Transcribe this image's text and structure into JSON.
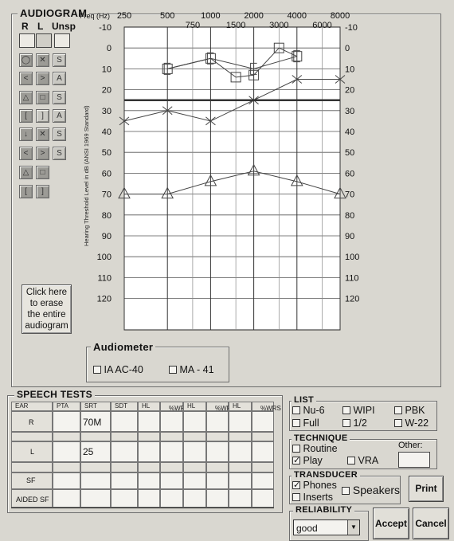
{
  "audiogram": {
    "title": "AUDIOGRAM",
    "ear_labels": [
      "R",
      "L",
      "Unsp"
    ],
    "freq_axis_label": "Freq (Hz)",
    "freq_top": [
      "250",
      "500",
      "1000",
      "2000",
      "4000",
      "8000"
    ],
    "freq_mid": [
      "750",
      "1500",
      "3000",
      "6000"
    ],
    "db_ticks": [
      "-10",
      "0",
      "10",
      "20",
      "30",
      "40",
      "50",
      "60",
      "70",
      "80",
      "90",
      "100",
      "110",
      "120"
    ],
    "y_axis_label": "Hearing Threshold Level in dB (ANSI 1969 Standard)",
    "erase_button": [
      "Click here",
      "to erase",
      "the entire",
      "audiogram"
    ]
  },
  "chart_data": {
    "type": "line",
    "x_scale": "log",
    "x_labels_major": [
      "250",
      "500",
      "1000",
      "2000",
      "4000",
      "8000"
    ],
    "x_labels_minor": [
      "750",
      "1500",
      "3000",
      "6000"
    ],
    "ylim": [
      -10,
      120
    ],
    "y_inverted": true,
    "y_ticks": [
      -10,
      0,
      10,
      20,
      30,
      40,
      50,
      60,
      70,
      80,
      90,
      100,
      110,
      120
    ],
    "ylabel": "Hearing Threshold Level in dB (ANSI 1969 Standard)",
    "xlabel": "Freq (Hz)",
    "grid": true,
    "series": [
      {
        "symbol": "square",
        "x": [
          500,
          1000,
          1500,
          2000,
          3000,
          4000
        ],
        "y": [
          10,
          5,
          14,
          13,
          0,
          4
        ]
      },
      {
        "symbol": "bracket",
        "x": [
          500,
          1000,
          2000,
          4000
        ],
        "y": [
          10,
          5,
          10,
          4
        ]
      },
      {
        "symbol": "x",
        "x": [
          250,
          500,
          1000,
          2000,
          4000,
          8000
        ],
        "y": [
          35,
          30,
          35,
          25,
          15,
          15
        ]
      },
      {
        "symbol": "triangle",
        "x": [
          250,
          500,
          1000,
          2000,
          4000,
          8000
        ],
        "y": [
          70,
          70,
          64,
          59,
          64,
          70
        ]
      },
      {
        "symbol": "line",
        "x": [
          250,
          8000
        ],
        "y": [
          25,
          25
        ]
      }
    ]
  },
  "audiometer": {
    "title": "Audiometer",
    "options": [
      {
        "label": "IA AC-40",
        "checked": false
      },
      {
        "label": "MA - 41",
        "checked": false
      }
    ]
  },
  "speech": {
    "title": "SPEECH TESTS",
    "headers": [
      "EAR",
      "PTA",
      "SRT",
      "SDT",
      "HL",
      "%WRS",
      "HL",
      "%WRS",
      "HL",
      "%WRS"
    ],
    "rows": [
      {
        "label": "R",
        "srt": "70M"
      },
      {
        "label": "L",
        "srt": "25"
      },
      {
        "label": "SF",
        "srt": ""
      },
      {
        "label": "AIDED SF",
        "srt": ""
      }
    ]
  },
  "list": {
    "title": "LIST",
    "options": [
      {
        "label": "Nu-6",
        "checked": false
      },
      {
        "label": "WIPI",
        "checked": false
      },
      {
        "label": "PBK",
        "checked": false
      },
      {
        "label": "Full",
        "checked": false
      },
      {
        "label": "1/2",
        "checked": false
      },
      {
        "label": "W-22",
        "checked": false
      }
    ]
  },
  "technique": {
    "title": "TECHNIQUE",
    "options": [
      {
        "label": "Routine",
        "checked": false
      },
      {
        "label": "Play",
        "checked": true
      },
      {
        "label": "VRA",
        "checked": false
      }
    ],
    "other_label": "Other:"
  },
  "transducer": {
    "title": "TRANSDUCER",
    "options": [
      {
        "label": "Phones",
        "checked": true
      },
      {
        "label": "Inserts",
        "checked": false
      },
      {
        "label": "Speakers",
        "checked": false
      }
    ]
  },
  "reliability": {
    "title": "RELIABILITY",
    "selected": "good"
  },
  "buttons": {
    "print": "Print",
    "accept": "Accept",
    "cancel": "Cancel"
  },
  "colors": {
    "background": "#d9d7d0",
    "chart_bg": "#ffffff",
    "plot_line": "#444444"
  }
}
